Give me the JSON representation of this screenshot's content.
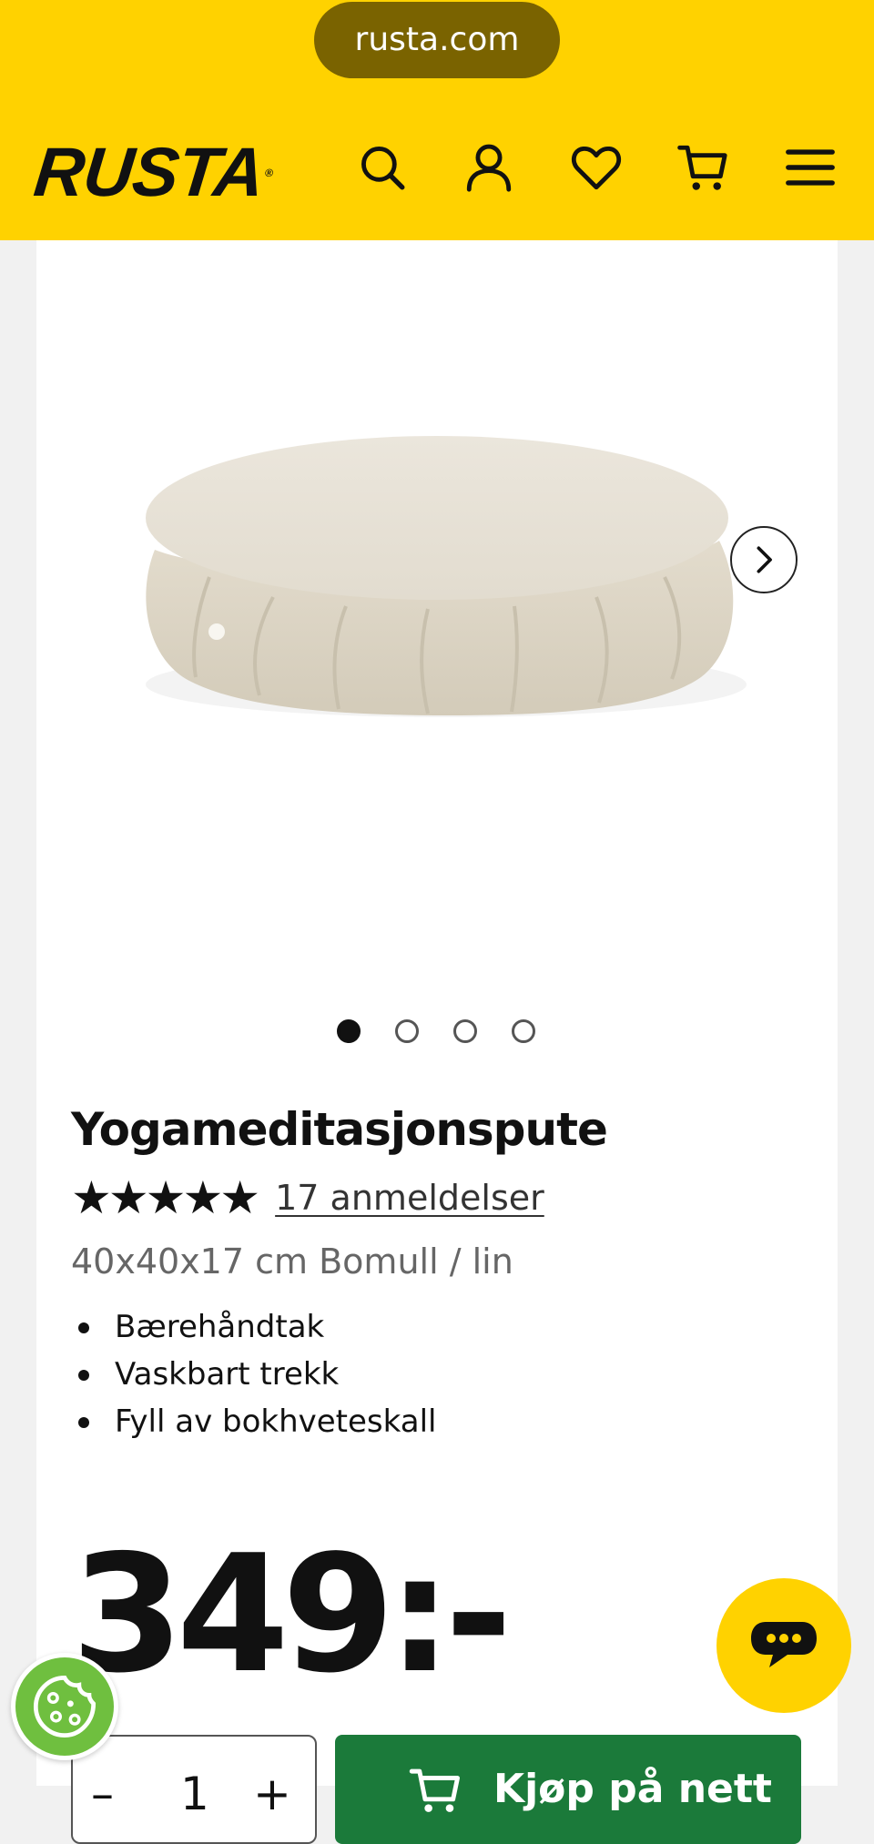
{
  "browser": {
    "url": "rusta.com"
  },
  "header": {
    "logo": "RUSTA",
    "icons": [
      "search-icon",
      "account-icon",
      "heart-icon",
      "cart-icon",
      "menu-icon"
    ],
    "background": "#ffd200"
  },
  "gallery": {
    "image_count": 4,
    "active_index": 0
  },
  "product": {
    "title": "Yogameditasjonspute",
    "rating": 5,
    "reviews_label": "17 anmeldelser",
    "subtitle": "40x40x17 cm Bomull / lin",
    "features": [
      "Bærehåndtak",
      "Vaskbart trekk",
      "Fyll av bokhveteskall"
    ],
    "price": "349:-"
  },
  "purchase": {
    "quantity": "1",
    "minus": "–",
    "plus": "+",
    "buy_label": "Kjøp på nett",
    "button_color": "#1b7a3a"
  },
  "floating": {
    "chat_icon": "chat-bubble-icon",
    "cookie_icon": "cookie-icon"
  }
}
